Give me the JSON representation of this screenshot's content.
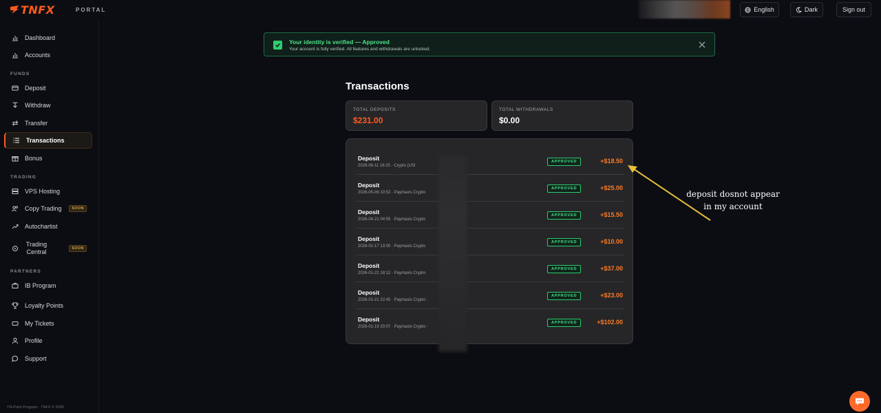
{
  "brand": {
    "logo_text": "TNFX",
    "portal_label": "PORTAL",
    "accent": "#ff5a1f"
  },
  "header": {
    "language_label": "English",
    "theme_label": "Dark",
    "signout_label": "Sign out"
  },
  "sidebar": {
    "items_top": [
      {
        "label": "Dashboard",
        "icon": "bar-chart-icon"
      },
      {
        "label": "Accounts",
        "icon": "bar-chart-icon"
      }
    ],
    "funds_label": "FUNDS",
    "funds_items": [
      {
        "label": "Deposit",
        "icon": "card-icon"
      },
      {
        "label": "Withdraw",
        "icon": "withdraw-icon"
      },
      {
        "label": "Transfer",
        "icon": "transfer-icon"
      },
      {
        "label": "Transactions",
        "icon": "list-icon",
        "active": true
      },
      {
        "label": "Bonus",
        "icon": "gift-icon"
      }
    ],
    "trading_label": "TRADING",
    "trading_items": [
      {
        "label": "VPS Hosting",
        "icon": "server-icon"
      },
      {
        "label": "Copy Trading",
        "icon": "users-icon",
        "badge": "SOON"
      },
      {
        "label": "Autochartist",
        "icon": "trend-icon"
      },
      {
        "label": "Trading Central",
        "icon": "target-icon",
        "badge": "SOON"
      }
    ],
    "partners_label": "PARTNERS",
    "partners_items": [
      {
        "label": "IB Program",
        "icon": "briefcase-icon"
      },
      {
        "label": "Loyalty Points",
        "icon": "trophy-icon"
      },
      {
        "label": "My Tickets",
        "icon": "ticket-icon"
      },
      {
        "label": "Profile",
        "icon": "user-icon"
      },
      {
        "label": "Support",
        "icon": "chat-icon"
      }
    ],
    "footer": "TN-Point Program · TNFX © 2026"
  },
  "alert": {
    "title": "Your identity is verified — Approved",
    "subtitle": "Your account is fully verified. All features and withdrawals are unlocked."
  },
  "page": {
    "title": "Transactions",
    "total_deposits_label": "TOTAL DEPOSITS",
    "total_deposits_value": "$231.00",
    "total_withdrawals_label": "TOTAL WITHDRAWALS",
    "total_withdrawals_value": "$0.00"
  },
  "transactions": [
    {
      "type": "Deposit",
      "meta": "2026-06-11 16:25 · Crypto (USI",
      "status": "APPROVED",
      "amount": "+$18.50"
    },
    {
      "type": "Deposit",
      "meta": "2026-05-06 10:52 · Paymaxis Crypto",
      "status": "APPROVED",
      "amount": "+$25.00"
    },
    {
      "type": "Deposit",
      "meta": "2026-04-21 04:55 · Paymaxis Crypto",
      "status": "APPROVED",
      "amount": "+$15.50"
    },
    {
      "type": "Deposit",
      "meta": "2026-02-17 13:00 · Paymaxis Crypto",
      "status": "APPROVED",
      "amount": "+$10.00"
    },
    {
      "type": "Deposit",
      "meta": "2026-01-22 18:12 · Paymaxis Crypto",
      "status": "APPROVED",
      "amount": "+$37.00"
    },
    {
      "type": "Deposit",
      "meta": "2026-01-21 22:45 · Paymaxis Crypto ·",
      "status": "APPROVED",
      "amount": "+$23.00"
    },
    {
      "type": "Deposit",
      "meta": "2026-01-19 20:07 · Paymaxis Crypto ·",
      "status": "APPROVED",
      "amount": "+$102.00"
    }
  ],
  "annotation": {
    "line1": "deposit dosnot appear",
    "line2": "in my account",
    "color": "#e6c13a"
  }
}
